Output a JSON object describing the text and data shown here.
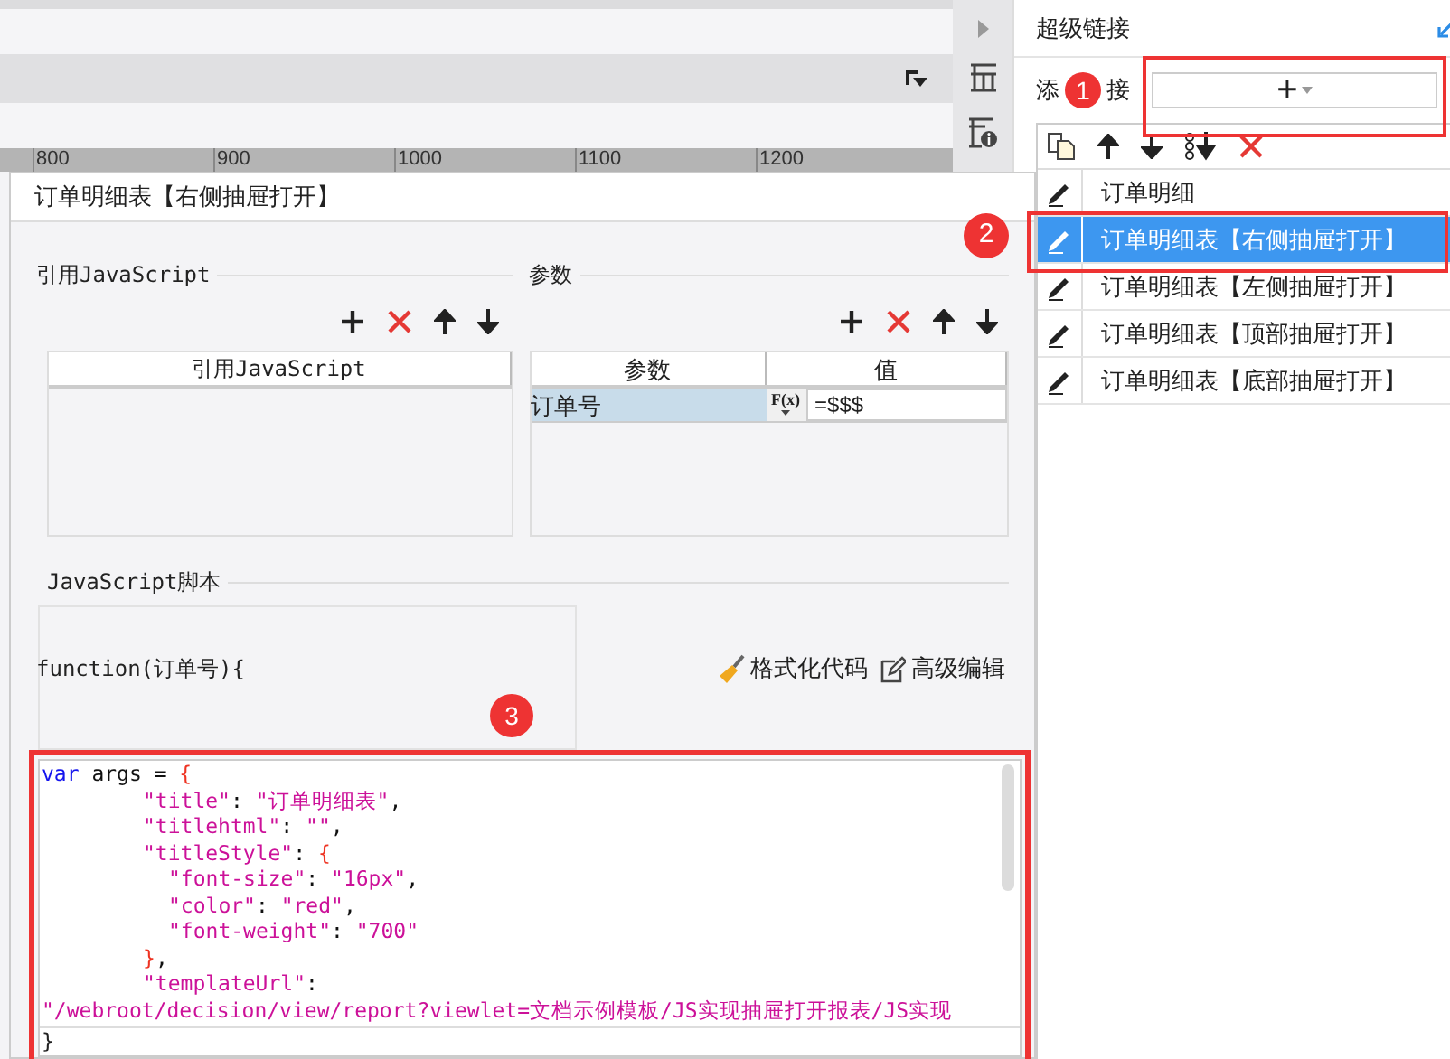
{
  "ruler": {
    "labels": [
      "800",
      "900",
      "1000",
      "1100",
      "1200"
    ]
  },
  "right_panel": {
    "title": "超级链接",
    "add_link_label_parts": [
      "添",
      "接"
    ],
    "add_button": "+",
    "links": [
      {
        "label": "订单明细",
        "selected": false
      },
      {
        "label": "订单明细表【右侧抽屉打开】",
        "selected": true
      },
      {
        "label": "订单明细表【左侧抽屉打开】",
        "selected": false
      },
      {
        "label": "订单明细表【顶部抽屉打开】",
        "selected": false
      },
      {
        "label": "订单明细表【底部抽屉打开】",
        "selected": false
      }
    ]
  },
  "dialog": {
    "title": "订单明细表【右侧抽屉打开】",
    "js_refs": {
      "title": "引用JavaScript",
      "columns": [
        "引用JavaScript"
      ]
    },
    "params": {
      "title": "参数",
      "columns": [
        "参数",
        "值"
      ],
      "rows": [
        {
          "name": "订单号",
          "fx": "F(x)",
          "value": "=$$$"
        }
      ]
    },
    "script": {
      "title": "JavaScript脚本",
      "signature": "function(订单号){",
      "format_button": "格式化代码",
      "advanced_button": "高级编辑",
      "code": [
        {
          "kind": "top",
          "tokens": [
            {
              "kind": "keyword",
              "text": "var"
            },
            {
              "kind": "plain",
              "text": " args = "
            },
            {
              "kind": "brace",
              "text": "{"
            }
          ]
        },
        {
          "kind": "inner",
          "tokens": [
            {
              "kind": "string",
              "text": "\"title\""
            },
            {
              "kind": "plain",
              "text": ": "
            },
            {
              "kind": "string",
              "text": "\"订单明细表\""
            },
            {
              "kind": "plain",
              "text": ","
            }
          ]
        },
        {
          "kind": "inner",
          "tokens": [
            {
              "kind": "string",
              "text": "\"titlehtml\""
            },
            {
              "kind": "plain",
              "text": ": "
            },
            {
              "kind": "string",
              "text": "\"\""
            },
            {
              "kind": "plain",
              "text": ","
            }
          ]
        },
        {
          "kind": "inner",
          "tokens": [
            {
              "kind": "string",
              "text": "\"titleStyle\""
            },
            {
              "kind": "plain",
              "text": ": "
            },
            {
              "kind": "brace",
              "text": "{"
            }
          ]
        },
        {
          "kind": "nested",
          "tokens": [
            {
              "kind": "string",
              "text": "\"font-size\""
            },
            {
              "kind": "plain",
              "text": ": "
            },
            {
              "kind": "string",
              "text": "\"16px\""
            },
            {
              "kind": "plain",
              "text": ","
            }
          ]
        },
        {
          "kind": "nested",
          "tokens": [
            {
              "kind": "string",
              "text": "\"color\""
            },
            {
              "kind": "plain",
              "text": ": "
            },
            {
              "kind": "string",
              "text": "\"red\""
            },
            {
              "kind": "plain",
              "text": ","
            }
          ]
        },
        {
          "kind": "nested",
          "tokens": [
            {
              "kind": "string",
              "text": "\"font-weight\""
            },
            {
              "kind": "plain",
              "text": ": "
            },
            {
              "kind": "string",
              "text": "\"700\""
            }
          ]
        },
        {
          "kind": "inner",
          "tokens": [
            {
              "kind": "brace",
              "text": "}"
            },
            {
              "kind": "plain",
              "text": ","
            }
          ]
        },
        {
          "kind": "inner",
          "tokens": [
            {
              "kind": "string",
              "text": "\"templateUrl\""
            },
            {
              "kind": "plain",
              "text": ":"
            }
          ]
        },
        {
          "kind": "top",
          "tokens": [
            {
              "kind": "string",
              "text": "\"/webroot/decision/view/report?viewlet=文档示例模板/JS实现抽屉打开报表/JS实现"
            }
          ]
        }
      ],
      "closing": "}"
    }
  },
  "annotations": [
    "1",
    "2",
    "3"
  ]
}
